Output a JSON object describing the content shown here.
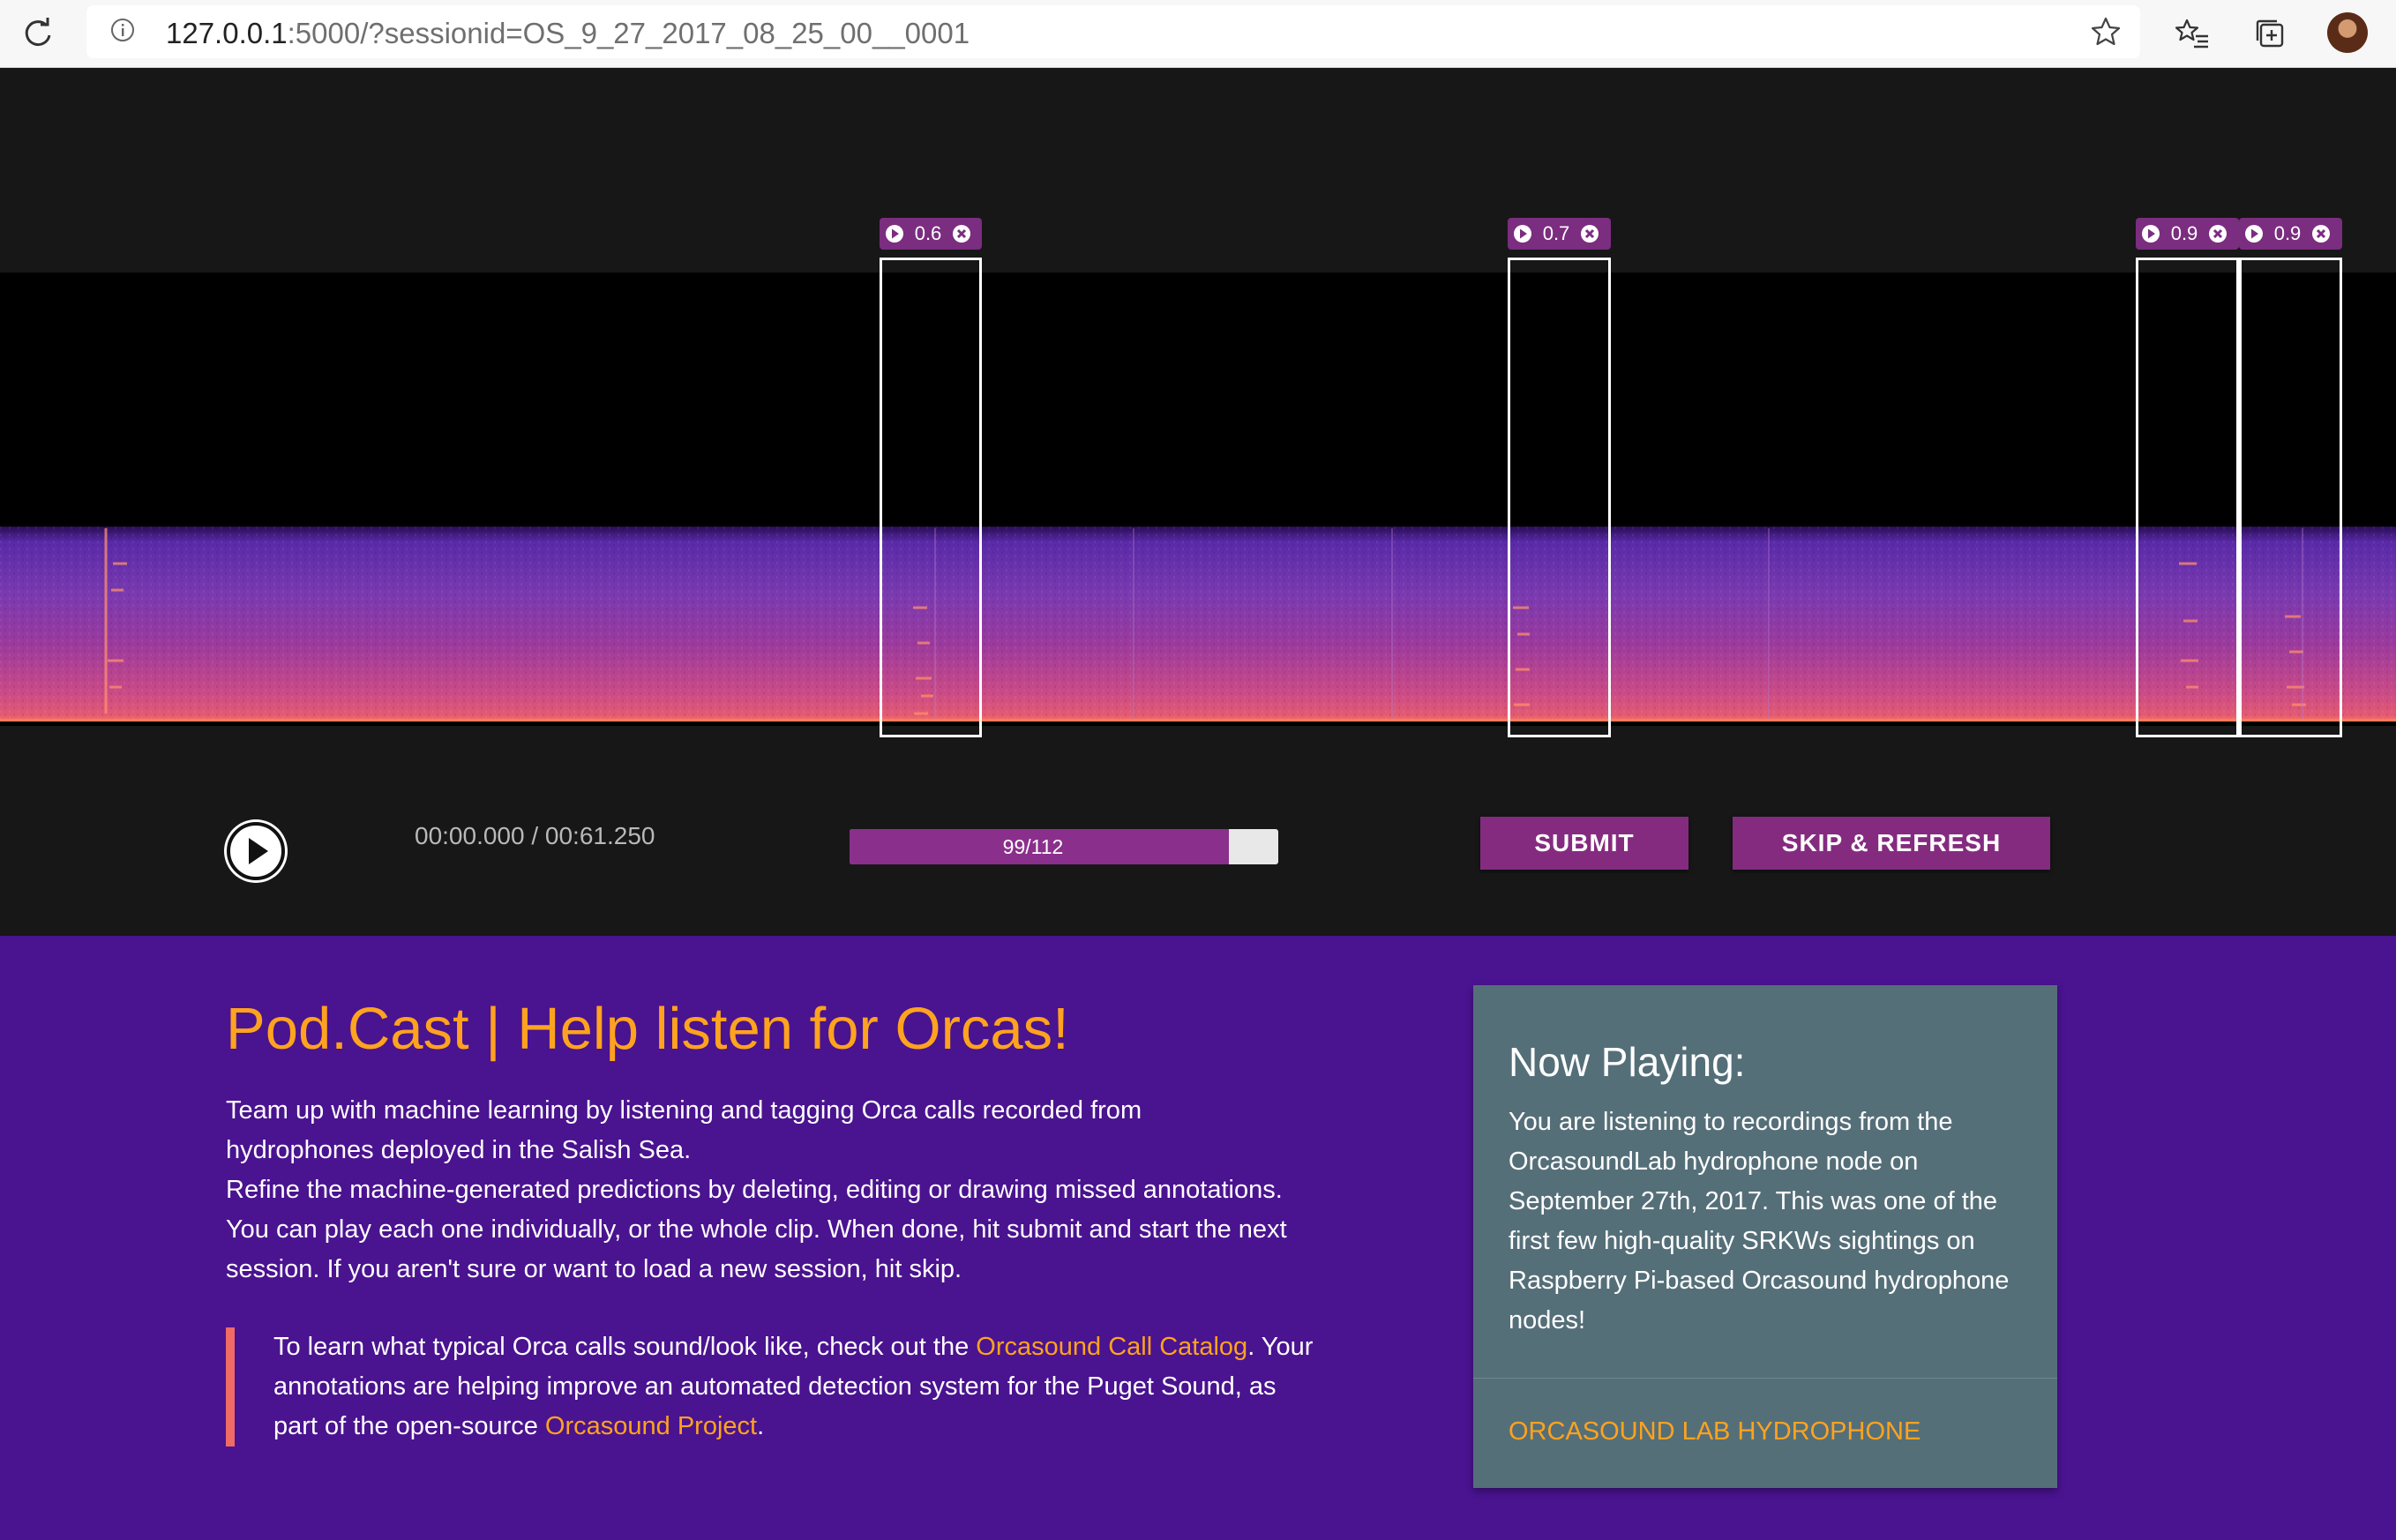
{
  "browser": {
    "url_host": "127.0.0.1",
    "url_rest": ":5000/?sessionid=OS_9_27_2017_08_25_00__0001"
  },
  "player": {
    "annotations": [
      {
        "confidence": "0.6"
      },
      {
        "confidence": "0.7"
      },
      {
        "confidence": "0.9"
      },
      {
        "confidence": "0.9"
      }
    ],
    "time_display": "00:00.000 / 00:61.250",
    "progress": {
      "current": 99,
      "total": 112,
      "label": "99/112",
      "fraction": 0.884
    },
    "submit_label": "SUBMIT",
    "skip_label": "SKIP & REFRESH"
  },
  "content": {
    "title": "Pod.Cast | Help listen for Orcas!",
    "intro_1": "Team up with machine learning by listening and tagging Orca calls recorded from hydrophones deployed in the Salish Sea.",
    "intro_2": "Refine the machine-generated predictions by deleting, editing or drawing missed annotations. You can play each one individually, or the whole clip. When done, hit submit and start the next session. If you aren't sure or want to load a new session, hit skip.",
    "quote_a": "To learn what typical Orca calls sound/look like, check out the ",
    "quote_link1": "Orcasound Call Catalog",
    "quote_b": ". Your annotations are helping improve an automated detection system for the Puget Sound, as part of the open-source ",
    "quote_link2": "Orcasound Project",
    "quote_c": "."
  },
  "now_playing": {
    "title": "Now Playing:",
    "text": "You are listening to recordings from the OrcasoundLab hydrophone node on September 27th, 2017. This was one of the first few high-quality SRKWs sightings on Raspberry Pi-based Orcasound hydrophone nodes!",
    "link": "ORCASOUND LAB HYDROPHONE"
  },
  "colors": {
    "accent_orange": "#ffa31f",
    "button_purple": "#842b80",
    "page_purple": "#4a1390",
    "card_slate": "#556f79"
  },
  "icons": [
    "reload-icon",
    "info-icon",
    "favorite-star-icon",
    "favorites-list-icon",
    "collections-icon",
    "play-icon",
    "close-icon"
  ]
}
